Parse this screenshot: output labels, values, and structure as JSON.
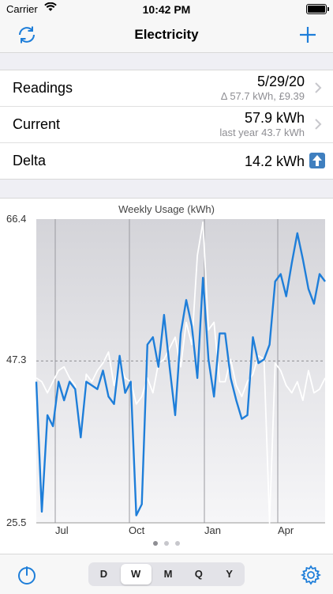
{
  "status": {
    "carrier": "Carrier",
    "time": "10:42 PM"
  },
  "nav": {
    "title": "Electricity",
    "refresh_icon": "refresh-icon",
    "add_icon": "add-icon",
    "tint": "#1e7ed9"
  },
  "rows": [
    {
      "label": "Readings",
      "main": "5/29/20",
      "sub": "Δ 57.7 kWh, £9.39"
    },
    {
      "label": "Current",
      "main": "57.9 kWh",
      "sub": "last year 43.7 kWh"
    },
    {
      "label": "Delta",
      "main": "14.2 kWh"
    }
  ],
  "chart_data": {
    "type": "line",
    "title": "Weekly Usage (kWh)",
    "ylim": [
      25.5,
      66.4
    ],
    "yticks": [
      "66.4",
      "47.3",
      "25.5"
    ],
    "xticks": [
      "Jul",
      "Oct",
      "Jan",
      "Apr"
    ],
    "reference_line": 47.3,
    "series": [
      {
        "color": "#1e7ed9",
        "values": [
          44.5,
          27.0,
          40.0,
          38.5,
          44.5,
          42.0,
          44.5,
          43.5,
          37.0,
          44.5,
          44.0,
          43.5,
          46.0,
          42.5,
          41.5,
          48.0,
          43.0,
          44.5,
          26.5,
          28.0,
          49.5,
          50.5,
          46.5,
          53.5,
          46.5,
          40.0,
          51.0,
          55.5,
          52.0,
          45.0,
          58.5,
          47.5,
          42.5,
          51.0,
          51.0,
          45.0,
          42.0,
          39.5,
          40.0,
          50.5,
          47.0,
          47.5,
          49.5,
          58.0,
          59.0,
          56.0,
          60.5,
          64.5,
          61.0,
          57.0,
          55.0,
          59.0,
          58.0
        ]
      },
      {
        "color": "#ffffff",
        "values": [
          45.0,
          44.5,
          43.0,
          44.5,
          46.0,
          46.5,
          45.0,
          44.0,
          37.0,
          45.5,
          44.5,
          46.0,
          47.0,
          48.5,
          44.0,
          47.0,
          45.0,
          44.5,
          41.5,
          42.5,
          45.0,
          43.0,
          47.0,
          47.5,
          49.0,
          50.5,
          46.5,
          52.5,
          49.5,
          61.5,
          66.0,
          51.5,
          52.5,
          44.5,
          44.5,
          47.5,
          44.0,
          42.5,
          44.5,
          45.5,
          48.0,
          47.5,
          25.5,
          47.0,
          46.0,
          44.0,
          43.0,
          44.5,
          42.0,
          46.0,
          43.0,
          43.5,
          45.0
        ]
      }
    ]
  },
  "pager": {
    "count": 3,
    "active": 0
  },
  "tabbar": {
    "segments": [
      "D",
      "W",
      "M",
      "Q",
      "Y"
    ],
    "selected": "W",
    "power_icon": "power-icon",
    "gear_icon": "gear-icon"
  }
}
